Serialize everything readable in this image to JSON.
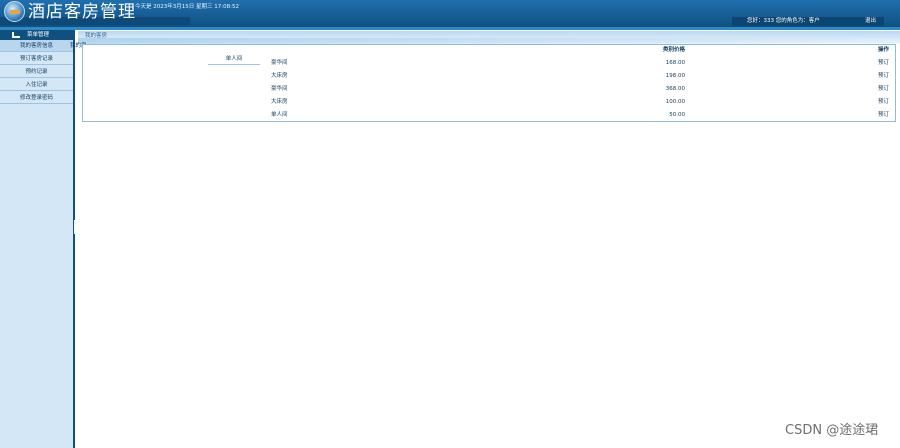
{
  "header": {
    "app_title": "酒店客房管理",
    "date_text": "今天是 2023年3月15日 星期三 17:08:52",
    "user_info": "您好：333 您的角色为：客户",
    "logout_label": "退出",
    "colors": {
      "header_bg": "#10507f",
      "header_top": "#1f6fae",
      "sidebar_bg": "#d4e7f6"
    }
  },
  "sidebar": {
    "head_label": "菜单管理",
    "head_icon": "menu-icon",
    "items": [
      {
        "label": "我的客房信息"
      },
      {
        "label": "预订客房记录"
      },
      {
        "label": "预约记录"
      },
      {
        "label": "入住记录"
      },
      {
        "label": "修改登录密码"
      }
    ]
  },
  "content": {
    "crumb": "我的客房",
    "crumb_sub": "我的房",
    "room_type_filter": "单人间",
    "columns": {
      "price": "类别价格",
      "action": "操作"
    },
    "rows": [
      {
        "name": "豪华间",
        "price": "168.00",
        "action": "预订"
      },
      {
        "name": "大床房",
        "price": "198.00",
        "action": "预订"
      },
      {
        "name": "豪华间",
        "price": "368.00",
        "action": "预订"
      },
      {
        "name": "大床房",
        "price": "100.00",
        "action": "预订"
      },
      {
        "name": "单人间",
        "price": "50.00",
        "action": "预订"
      }
    ]
  },
  "watermark": "CSDN @途途珺"
}
